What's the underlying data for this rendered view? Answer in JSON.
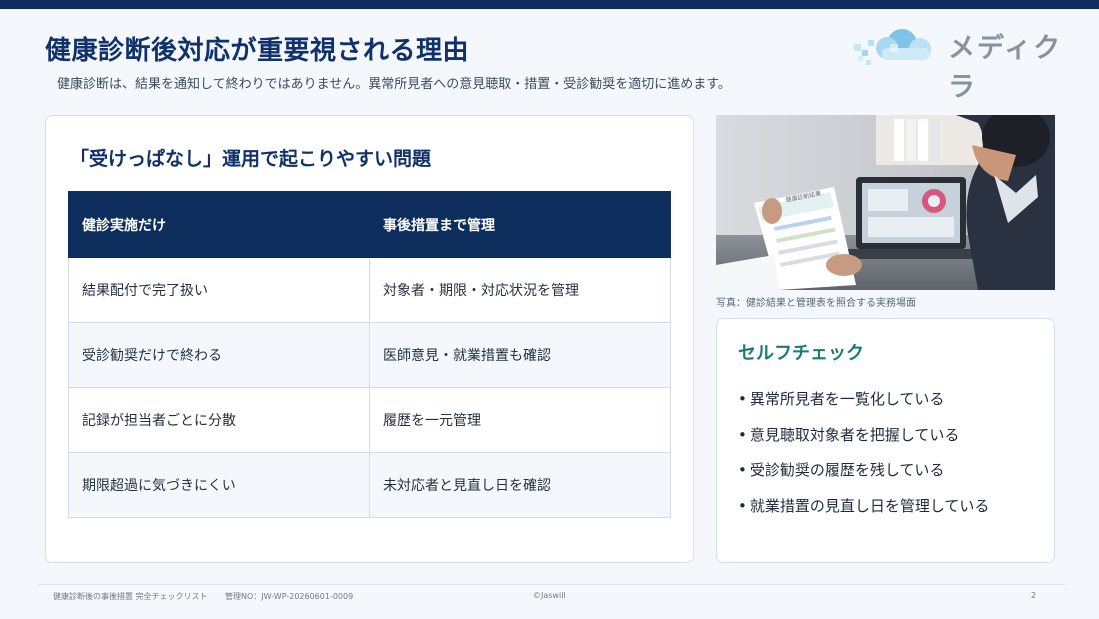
{
  "header": {
    "title": "健康診断後対応が重要視される理由",
    "subtitle": "健康診断は、結果を通知して終わりではありません。異常所見者への意見聴取・措置・受診勧奨を適切に進めます。",
    "logo_text": "メディクラ"
  },
  "problem_card": {
    "heading": "「受けっぱなし」運用で起こりやすい問題",
    "columns": [
      "健診実施だけ",
      "事後措置まで管理"
    ],
    "rows": [
      [
        "結果配付で完了扱い",
        "対象者・期限・対応状況を管理"
      ],
      [
        "受診勧奨だけで終わる",
        "医師意見・就業措置も確認"
      ],
      [
        "記録が担当者ごとに分散",
        "履歴を一元管理"
      ],
      [
        "期限超過に気づきにくい",
        "未対応者と見直し日を確認"
      ]
    ]
  },
  "photo": {
    "caption": "写真：健診結果と管理表を照合する実務場面",
    "document_title": "健康診断結果"
  },
  "self_check": {
    "heading": "セルフチェック",
    "bullet": "•",
    "items": [
      "異常所見者を一覧化している",
      "意見聴取対象者を把握している",
      "受診勧奨の履歴を残している",
      "就業措置の見直し日を管理している"
    ]
  },
  "footer": {
    "doc_name": "健康診断後の事後措置 完全チェックリスト",
    "control_no": "管理NO：JW-WP-20260601-0009",
    "copyright": "©Jaswill",
    "page": "2"
  },
  "colors": {
    "navy": "#0d2d5c",
    "title": "#11316a",
    "teal": "#1a7a74",
    "background": "#f4f8fc"
  }
}
